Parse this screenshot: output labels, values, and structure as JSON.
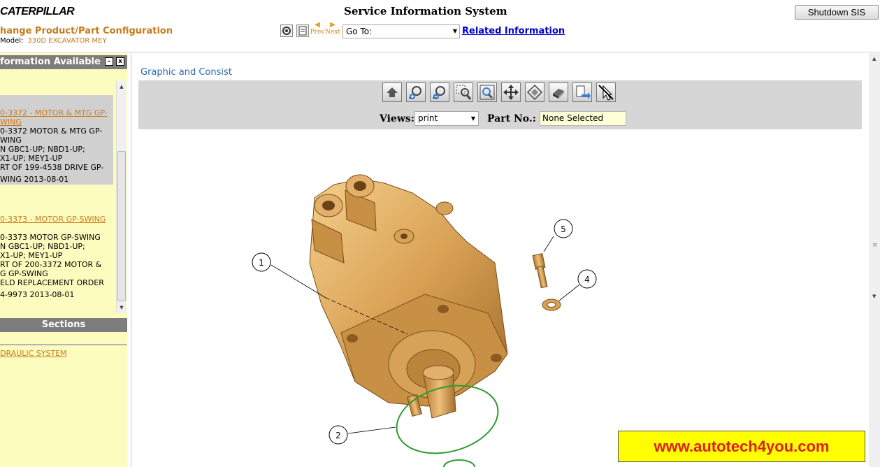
{
  "header": {
    "brand": "CATERPILLAR",
    "system_title": "Service Information System",
    "product_title": "hange Product/Part Configuration",
    "model_label": "Model:",
    "model_value": "330D EXCAVATOR MEY",
    "shutdown_label": "Shutdown SIS",
    "prev_label": "Prev",
    "next_label": "Next",
    "goto_value": "Go To:",
    "related_label": "Related Information"
  },
  "left_panel": {
    "info_title": "formation Available",
    "minimize_glyph": "–",
    "close_glyph": "x",
    "entries": [
      {
        "link": "0-3372 - MOTOR & MTG GP-",
        "link2": "WING",
        "lines": [
          "0-3372 MOTOR & MTG GP-",
          "WING",
          "N GBC1-UP; NBD1-UP;",
          "X1-UP; MEY1-UP",
          "RT OF 199-4538 DRIVE GP-",
          "WING 2013-08-01"
        ]
      },
      {
        "link": "0-3373 - MOTOR GP-SWING",
        "lines": [
          "0-3373 MOTOR GP-SWING",
          "N GBC1-UP; NBD1-UP;",
          "X1-UP; MEY1-UP",
          "RT OF 200-3372 MOTOR &",
          "G GP-SWING",
          "ELD REPLACEMENT ORDER",
          "4-9973 2013-08-01"
        ]
      }
    ],
    "sections_title": "Sections",
    "section_link": "DRAULIC SYSTEM"
  },
  "content": {
    "heading": "Graphic and Consist",
    "views_label": "Views:",
    "views_value": "print",
    "partno_label": "Part No.:",
    "partno_value": "None Selected",
    "toolbar_icons": [
      "home-icon",
      "zoom-in-icon",
      "zoom-out-icon",
      "zoom-area-icon",
      "zoom-fit-icon",
      "pan-icon",
      "center-icon",
      "print-icon",
      "export-icon",
      "pointer-icon"
    ],
    "callouts": [
      "1",
      "2",
      "4",
      "5"
    ]
  },
  "watermark": "www.autotech4you.com",
  "colors": {
    "accent_orange": "#c87a1c",
    "link_blue": "#0000cc",
    "panel_yellow": "#fcfcbe",
    "part_bronze": "#d9a154",
    "oring_green": "#2e9a2e"
  }
}
